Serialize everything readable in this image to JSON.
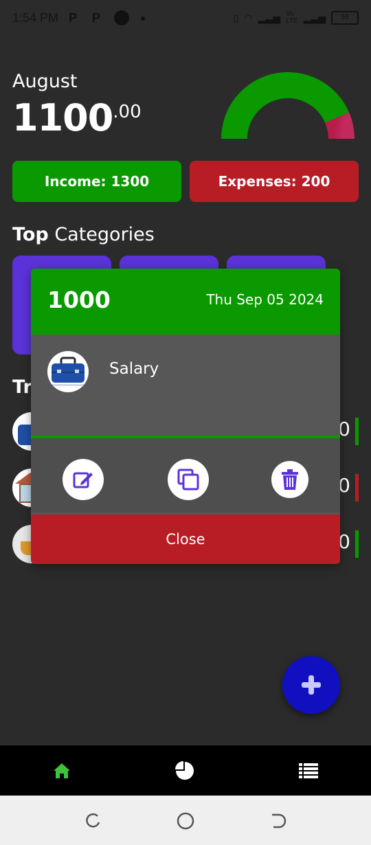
{
  "status_bar": {
    "time": "1:54 PM",
    "icons": [
      "p-icon",
      "p-icon",
      "app-icon",
      "dot"
    ],
    "battery": "59"
  },
  "summary": {
    "month": "August",
    "balance_main": "1100",
    "balance_cents": ".00",
    "income_label": "Income: 1300",
    "expense_label": "Expenses: 200",
    "gauge_income_fraction": 0.87
  },
  "top_categories": {
    "title_bold": "Top",
    "title_rest": "Categories"
  },
  "transactions": {
    "title": "Tr",
    "rows": [
      {
        "amount_suffix": "0",
        "color": "#0a9a00",
        "icon": "briefcase-icon"
      },
      {
        "amount_suffix": "0",
        "color": "#b81d25",
        "icon": "house-icon"
      },
      {
        "amount_suffix": "0",
        "color": "#0a9a00",
        "icon": "tea-icon"
      }
    ]
  },
  "modal": {
    "amount": "1000",
    "date": "Thu Sep 05 2024",
    "category": "Salary",
    "close_label": "Close"
  },
  "colors": {
    "income": "#0a9a00",
    "expense": "#b81d25",
    "accent": "#5b32d8",
    "fab": "#1010c0"
  }
}
